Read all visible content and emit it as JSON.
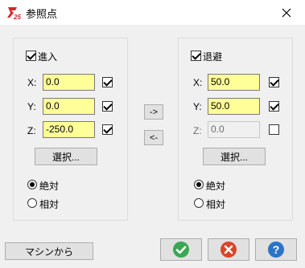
{
  "window": {
    "title": "参照点"
  },
  "approach": {
    "label": "進入",
    "checked": true,
    "x": {
      "label": "X:",
      "value": "0.0",
      "checked": true
    },
    "y": {
      "label": "Y:",
      "value": "0.0",
      "checked": true
    },
    "z": {
      "label": "Z:",
      "value": "-250.0",
      "checked": true
    },
    "select_label": "選択...",
    "mode_absolute": "絶対",
    "mode_relative": "相対",
    "mode": "絶対"
  },
  "retract": {
    "label": "退避",
    "checked": true,
    "x": {
      "label": "X:",
      "value": "50.0",
      "checked": true
    },
    "y": {
      "label": "Y:",
      "value": "50.0",
      "checked": true
    },
    "z": {
      "label": "Z:",
      "value": "0.0",
      "checked": false,
      "disabled": true
    },
    "select_label": "選択...",
    "mode_absolute": "絶対",
    "mode_relative": "相対",
    "mode": "絶対"
  },
  "copy": {
    "to_right": "->",
    "to_left": "<-"
  },
  "footer": {
    "from_machine": "マシンから",
    "ok_icon": "check-icon",
    "cancel_icon": "x-icon",
    "help_icon": "question-icon"
  },
  "colors": {
    "field_bg": "#ffff99",
    "ok": "#3aa853",
    "cancel": "#d9452b",
    "help": "#2b74c7"
  }
}
